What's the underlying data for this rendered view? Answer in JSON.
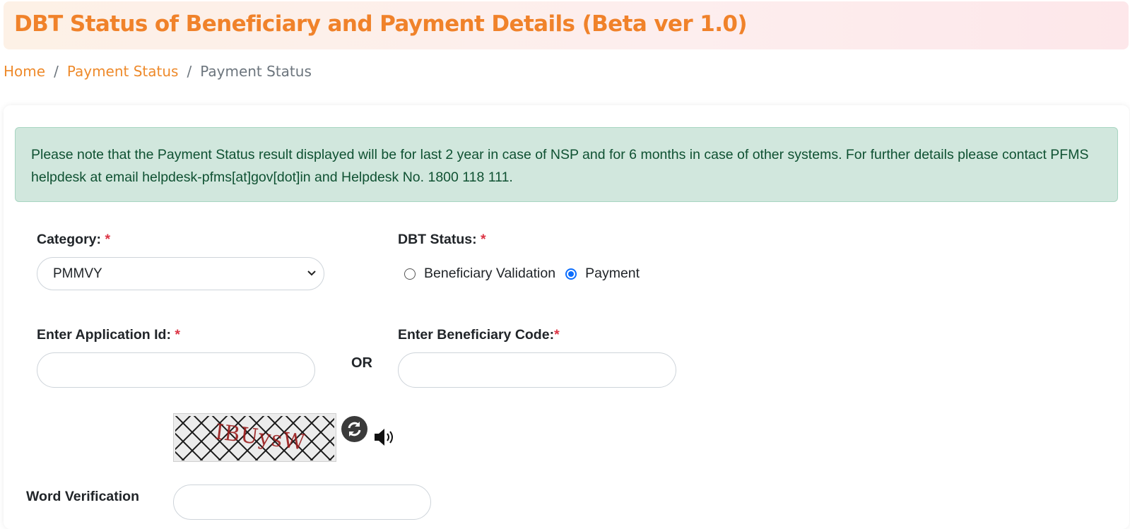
{
  "header": {
    "title": "DBT Status of Beneficiary and Payment Details (Beta ver 1.0)"
  },
  "breadcrumb": {
    "items": [
      "Home",
      "Payment Status",
      "Payment Status"
    ],
    "separator": "/"
  },
  "notice": {
    "text": "Please note that the Payment Status result displayed will be for last 2 year in case of NSP and for 6 months in case of other systems. For further details please contact PFMS helpdesk at email helpdesk-pfms[at]gov[dot]in and Helpdesk No. 1800 118 111."
  },
  "form": {
    "category_label": "Category:",
    "category_value": "PMMVY",
    "dbt_status_label": "DBT Status:",
    "dbt_options": [
      "Beneficiary Validation",
      "Payment"
    ],
    "dbt_selected": "Payment",
    "application_id_label": "Enter Application Id:",
    "application_id_value": "",
    "or_label": "OR",
    "beneficiary_code_label": "Enter Beneficiary Code:",
    "beneficiary_code_value": "",
    "required_marker": "*",
    "captcha_text": "IBUysW",
    "word_verification_label": "Word Verification",
    "word_verification_value": ""
  },
  "colors": {
    "brand_orange": "#f0822a",
    "link_orange": "#ee8a2b",
    "alert_bg": "#d1e7dd",
    "alert_text": "#0f5132",
    "required_red": "#dc3545",
    "radio_blue": "#0d6efd"
  },
  "icons": {
    "category_dropdown": "chevron-down-icon",
    "captcha_refresh": "refresh-icon",
    "captcha_audio": "speaker-icon"
  }
}
